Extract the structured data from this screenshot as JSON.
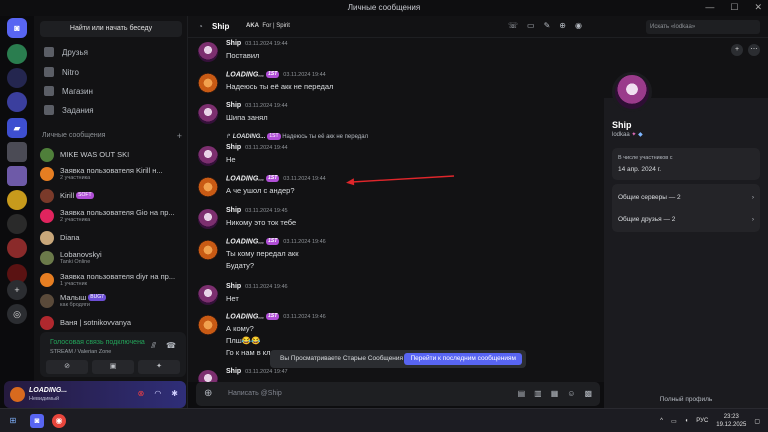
{
  "window": {
    "title": "Личные сообщения"
  },
  "sidebar": {
    "find_button": "Найти или начать беседу",
    "nav": [
      {
        "label": "Друзья",
        "icon": "friends-icon"
      },
      {
        "label": "Nitro",
        "icon": "nitro-icon"
      },
      {
        "label": "Магазин",
        "icon": "shop-icon"
      },
      {
        "label": "Задания",
        "icon": "quests-icon"
      }
    ],
    "dm_header": "Личные сообщения",
    "dms": [
      {
        "name": "MIKE WAS OUT SKI",
        "sub": "",
        "badge": ""
      },
      {
        "name": "Заявка пользователя Kirill н...",
        "sub": "2 участника",
        "badge": ""
      },
      {
        "name": "Kirill",
        "sub": "",
        "badge": "SOFT"
      },
      {
        "name": "Заявка пользователя Gio на пр...",
        "sub": "2 участника",
        "badge": ""
      },
      {
        "name": "Diana",
        "sub": "",
        "badge": ""
      },
      {
        "name": "Lobanovskyi",
        "sub": "Tanki Online",
        "badge": ""
      },
      {
        "name": "Заявка пользователя diyr на пр...",
        "sub": "1 участник",
        "badge": ""
      },
      {
        "name": "Малыш",
        "sub": "как бродяги",
        "badge": "BUG7"
      },
      {
        "name": "Ваня | sotnikovvanya",
        "sub": "",
        "badge": ""
      }
    ]
  },
  "voice": {
    "title": "Голосовая связь подключена",
    "sub": "STREAM / Valerian Zone"
  },
  "user_panel": {
    "name": "LOADING...",
    "status": "Невидимый"
  },
  "header": {
    "name": "Ship",
    "aka_label": "AKA",
    "aka_value": "For | Spirit",
    "search_placeholder": "Искать «lodkaa»"
  },
  "messages": [
    {
      "author": "Ship",
      "ts": "03.11.2024 19:44",
      "lines": [
        "Поставил"
      ],
      "kind": "ship"
    },
    {
      "author": "LOADING...",
      "ts": "03.11.2024 19:44",
      "lines": [
        "Надеюсь ты её акк не передал"
      ],
      "kind": "load",
      "badge": "1ST"
    },
    {
      "author": "Ship",
      "ts": "03.11.2024 19:44",
      "lines": [
        "Шипа занял"
      ],
      "kind": "ship"
    },
    {
      "author": "Ship",
      "ts": "03.11.2024 19:44",
      "lines": [
        "Не"
      ],
      "kind": "ship",
      "reply": "Надеюсь ты её акк не передал"
    },
    {
      "author": "LOADING...",
      "ts": "03.11.2024 19:44",
      "lines": [
        "А че ушол с андер?"
      ],
      "kind": "load",
      "badge": "1ST"
    },
    {
      "author": "Ship",
      "ts": "03.11.2024 19:45",
      "lines": [
        "Никому это ток тебе"
      ],
      "kind": "ship"
    },
    {
      "author": "LOADING...",
      "ts": "03.11.2024 19:46",
      "lines": [
        "Ты кому передал акк",
        "Будату?"
      ],
      "kind": "load",
      "badge": "1ST"
    },
    {
      "author": "Ship",
      "ts": "03.11.2024 19:46",
      "lines": [
        "Нет"
      ],
      "kind": "ship"
    },
    {
      "author": "LOADING...",
      "ts": "03.11.2024 19:46",
      "lines": [
        "А кому?",
        "Плш😂😂",
        "Го к нам в кла..."
      ],
      "kind": "load",
      "badge": "1ST"
    },
    {
      "author": "Ship",
      "ts": "03.11.2024 19:47",
      "lines": [
        ""
      ],
      "kind": "ship"
    }
  ],
  "reply_author": "LOADING...",
  "reply_badge": "1ST",
  "toast": {
    "text": "Вы Просматриваете Старые Сообщения",
    "button": "Перейти к последним сообщениям"
  },
  "composer": {
    "placeholder": "Написать @Ship"
  },
  "profile": {
    "name": "Ship",
    "tag": "lodkaa",
    "member_since_label": "В числе участников с",
    "member_since": "14 апр. 2024 г.",
    "mutual_servers": "Общие серверы — 2",
    "mutual_friends": "Общие друзья — 2",
    "full_profile": "Полный профиль"
  },
  "taskbar": {
    "lang": "РУС",
    "time": "23:23",
    "date": "19.12.2025"
  },
  "colors": {
    "accent": "#5865f2",
    "voice_green": "#23a55a",
    "badge_purple": "#b04ed6",
    "annotation_arrow": "#e0262b"
  }
}
